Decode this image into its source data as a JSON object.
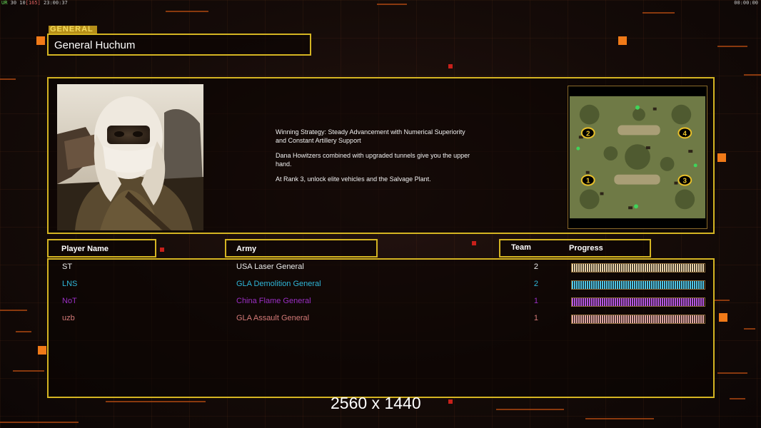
{
  "hud": {
    "fps_prefix": "UR",
    "fps_text": "30 10",
    "frame_bracket": "[165]",
    "clock": "23:00:37",
    "timer": "00:00:00"
  },
  "general": {
    "tag": "GENERAL",
    "name": "General Huchum"
  },
  "strategy": {
    "lines": [
      "Winning Strategy: Steady Advancement with Numerical Superiority\n and Constant Artillery Support",
      "Dana Howitzers combined with upgraded tunnels give you the upper\n hand.",
      "At Rank 3, unlock elite vehicles and the Salvage Plant."
    ]
  },
  "map": {
    "start_positions": [
      "2",
      "4",
      "1",
      "3"
    ]
  },
  "columns": {
    "player_name": "Player Name",
    "army": "Army",
    "team": "Team",
    "progress": "Progress"
  },
  "players": [
    {
      "name": "ST",
      "army": "USA Laser General",
      "team": "2",
      "color": "#e8e8e8",
      "bar_color": "#e8d2a8",
      "progress": 1.0
    },
    {
      "name": "LNS",
      "army": "GLA Demolition General",
      "team": "2",
      "color": "#2fb6d8",
      "bar_color": "#4fc6e6",
      "progress": 1.0
    },
    {
      "name": "NoT",
      "army": "China Flame General",
      "team": "1",
      "color": "#9a2fc4",
      "bar_color": "#b658e0",
      "progress": 1.0
    },
    {
      "name": "uzb",
      "army": "GLA Assault General",
      "team": "1",
      "color": "#d47a78",
      "bar_color": "#e0a6a2",
      "progress": 1.0
    }
  ],
  "footer": {
    "resolution": "2560 x 1440"
  },
  "colors": {
    "panel_border": "#d4b422",
    "accent_orange": "#f07a18",
    "background": "#150b08"
  }
}
